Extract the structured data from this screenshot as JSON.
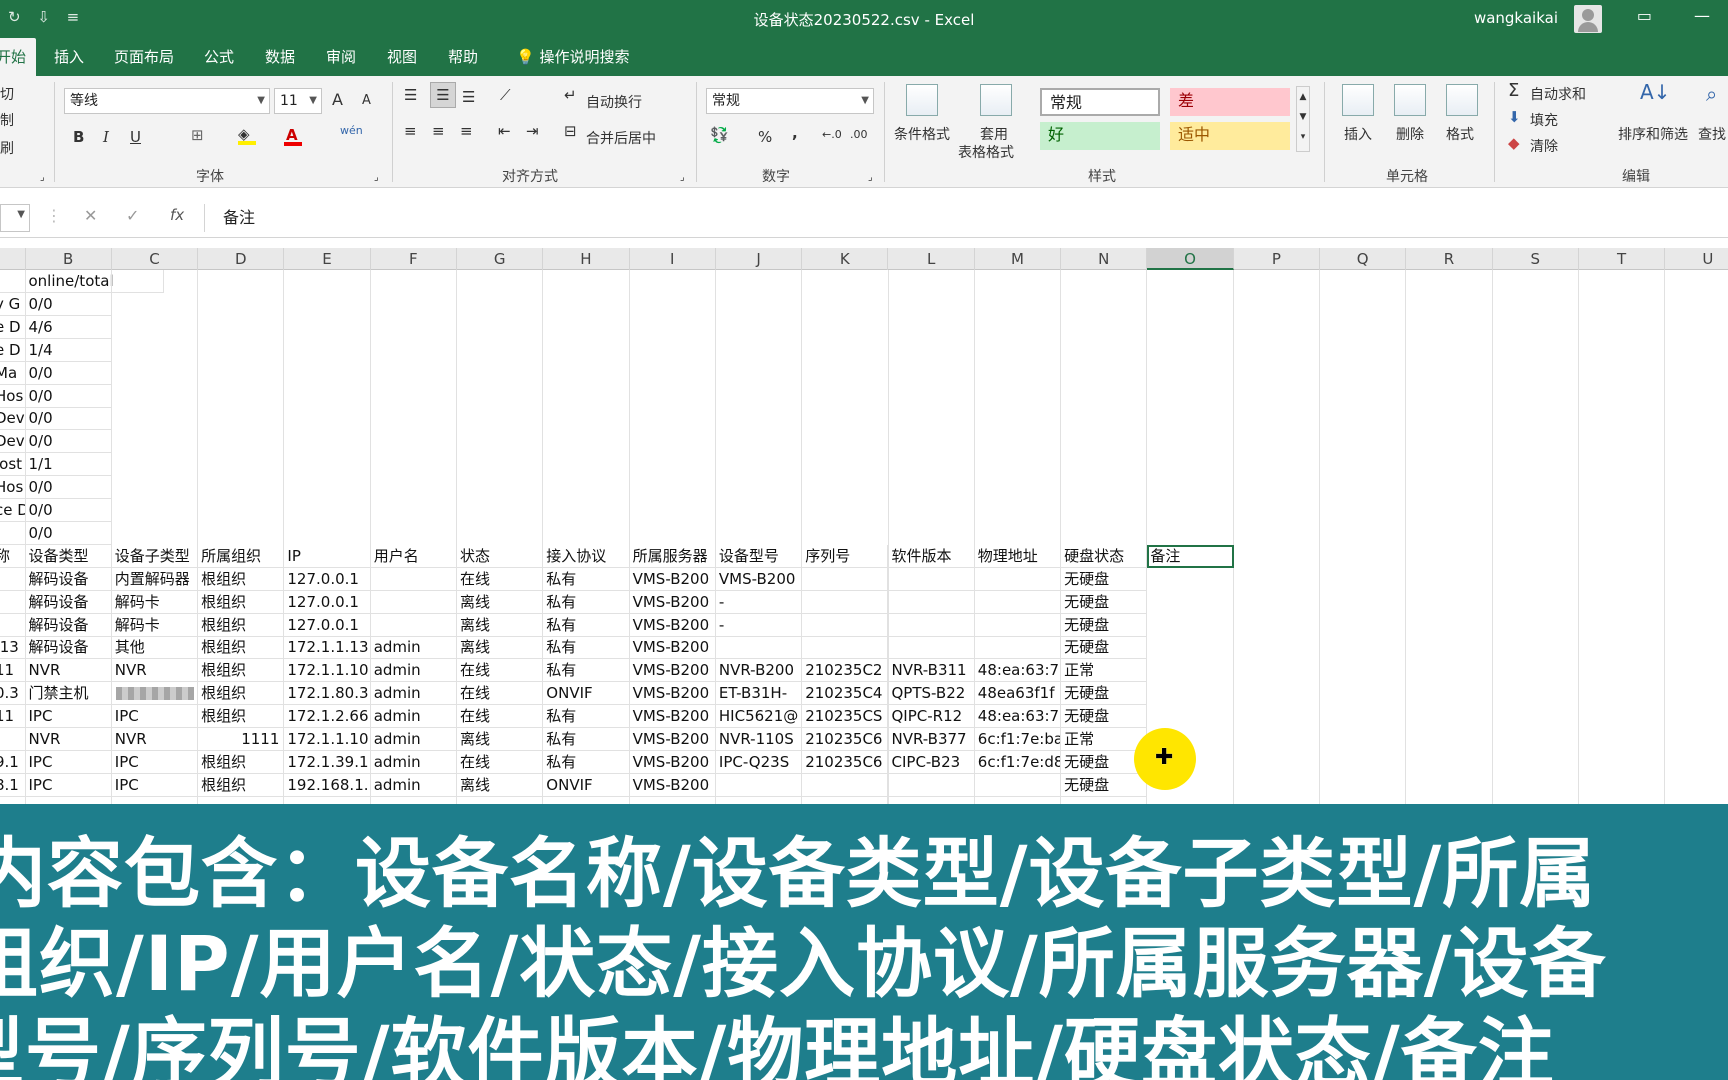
{
  "window": {
    "title": "设备状态20230522.csv - Excel",
    "user": "wangkaikai"
  },
  "tabs": [
    "开始",
    "插入",
    "页面布局",
    "公式",
    "数据",
    "审阅",
    "视图",
    "帮助",
    "操作说明搜索"
  ],
  "ribbon": {
    "clipboard": {
      "cut": "剪切",
      "copy": "复制",
      "painter": "格式刷"
    },
    "font": {
      "name": "等线",
      "size": "11",
      "grow": "A",
      "shrink": "A",
      "bold": "B",
      "italic": "I",
      "underline": "U",
      "phonetic": "wén",
      "label": "字体"
    },
    "alignment": {
      "wrap": "自动换行",
      "merge": "合并后居中",
      "label": "对齐方式"
    },
    "number": {
      "format": "常规",
      "percent": "%",
      "comma": ",",
      "label": "数字"
    },
    "styles": {
      "conditional": "条件格式",
      "table_format_1": "套用",
      "table_format_2": "表格格式",
      "normal": "常规",
      "bad": "差",
      "good": "好",
      "neutral": "适中",
      "label": "样式"
    },
    "cells": {
      "insert": "插入",
      "delete": "删除",
      "format": "格式",
      "label": "单元格"
    },
    "editing": {
      "autosum": "自动求和",
      "fill": "填充",
      "clear": "清除",
      "sort": "排序和筛选",
      "find": "查找",
      "label": "编辑"
    }
  },
  "formula_bar": {
    "cancel": "✕",
    "enter": "✓",
    "fx": "fx",
    "content": "备注"
  },
  "columns": [
    "B",
    "C",
    "D",
    "E",
    "F",
    "G",
    "H",
    "I",
    "J",
    "K",
    "L",
    "M",
    "N",
    "O",
    "P",
    "Q",
    "R",
    "S",
    "T",
    "U"
  ],
  "selected_column": "O",
  "grid": {
    "summary_header": "online/total",
    "summary_rows": [
      [
        "y G",
        "0/0"
      ],
      [
        "e D",
        "4/6"
      ],
      [
        "e D",
        "1/4"
      ],
      [
        "Ma",
        "0/0"
      ],
      [
        "Hos",
        "0/0"
      ],
      [
        "Dev",
        "0/0"
      ],
      [
        "Dev",
        "0/0"
      ],
      [
        "lost",
        "1/1"
      ],
      [
        "Hos",
        "0/0"
      ],
      [
        "ce D",
        "0/0"
      ],
      [
        "",
        "0/0"
      ]
    ],
    "headers": [
      "称",
      "设备类型",
      "设备子类型",
      "所属组织",
      "IP",
      "用户名",
      "状态",
      "接入协议",
      "所属服务器",
      "设备型号",
      "序列号",
      "软件版本",
      "物理地址",
      "硬盘状态",
      "备注"
    ],
    "rows": [
      [
        "",
        "解码设备",
        "内置解码器",
        "根组织",
        "127.0.0.1",
        "",
        "在线",
        "私有",
        "VMS-B200",
        "VMS-B200",
        "",
        "",
        "",
        "无硬盘"
      ],
      [
        "",
        "解码设备",
        "解码卡",
        "根组织",
        "127.0.0.1",
        "",
        "离线",
        "私有",
        "VMS-B200",
        "-",
        "",
        "",
        "",
        "无硬盘"
      ],
      [
        "",
        "解码设备",
        "解码卡",
        "根组织",
        "127.0.0.1",
        "",
        "离线",
        "私有",
        "VMS-B200",
        "-",
        "",
        "",
        "",
        "无硬盘"
      ],
      [
        ".13",
        "解码设备",
        "其他",
        "根组织",
        "172.1.1.13",
        "admin",
        "离线",
        "私有",
        "VMS-B200",
        "",
        "",
        "",
        "",
        "无硬盘"
      ],
      [
        "11",
        "NVR",
        "NVR",
        "根组织",
        "172.1.1.10",
        "admin",
        "在线",
        "私有",
        "VMS-B200",
        "NVR-B200",
        "210235C2",
        "NVR-B311",
        "48:ea:63:7",
        "正常"
      ],
      [
        "0.3",
        "门禁主机",
        "",
        "根组织",
        "172.1.80.3",
        "admin",
        "在线",
        "ONVIF",
        "VMS-B200",
        "ET-B31H-",
        "210235C4",
        "QPTS-B22",
        "48ea63f1f",
        "无硬盘"
      ],
      [
        "11",
        "IPC",
        "IPC",
        "根组织",
        "172.1.2.66",
        "admin",
        "在线",
        "私有",
        "VMS-B200",
        "HIC5621@",
        "210235CS",
        "QIPC-R12",
        "48:ea:63:7",
        "无硬盘"
      ],
      [
        "",
        "NVR",
        "NVR",
        "1111",
        "172.1.1.10",
        "admin",
        "离线",
        "私有",
        "VMS-B200",
        "NVR-110S",
        "210235C6",
        "NVR-B377",
        "6c:f1:7e:ba",
        "正常"
      ],
      [
        "9.1",
        "IPC",
        "IPC",
        "根组织",
        "172.1.39.1",
        "admin",
        "在线",
        "私有",
        "VMS-B200",
        "IPC-Q23S",
        "210235C6",
        "CIPC-B23",
        "6c:f1:7e:d8",
        "无硬盘"
      ],
      [
        "8.1",
        "IPC",
        "IPC",
        "根组织",
        "192.168.1.",
        "admin",
        "离线",
        "ONVIF",
        "VMS-B200",
        "",
        "",
        "",
        "",
        "无硬盘"
      ]
    ]
  },
  "caption": [
    "内容包含：设备名称/设备类型/设备子类型/所属",
    "组织/IP/用户名/状态/接入协议/所属服务器/设备",
    "型号/序列号/软件版本/物理地址/硬盘状态/备注"
  ]
}
